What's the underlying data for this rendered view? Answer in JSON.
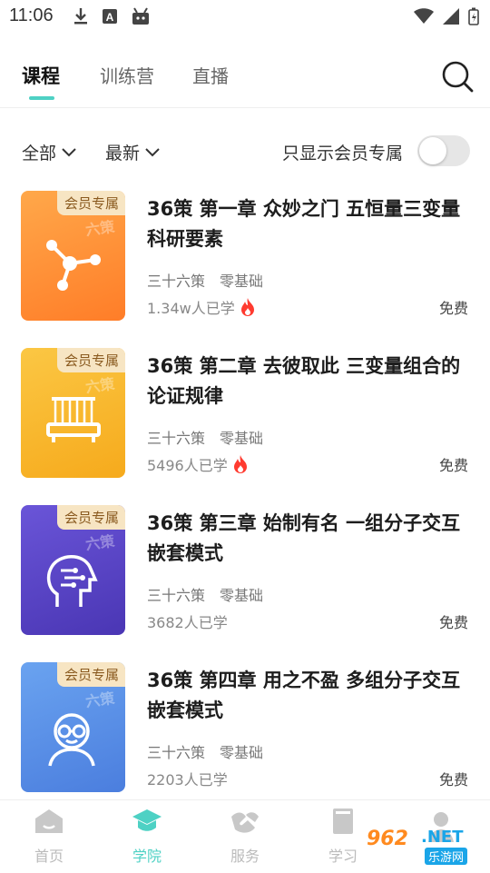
{
  "status_bar": {
    "time": "11:06"
  },
  "header": {
    "tabs": [
      {
        "label": "课程",
        "active": true
      },
      {
        "label": "训练营",
        "active": false
      },
      {
        "label": "直播",
        "active": false
      }
    ],
    "accent": "#4ed1c4"
  },
  "filters": {
    "category": "全部",
    "sort": "最新",
    "member_only_label": "只显示会员专属",
    "member_only_on": false
  },
  "courses": [
    {
      "badge": "会员专属",
      "watermark": "六策",
      "title": "36策 第一章 众妙之门 五恒量三变量科研要素",
      "series": "三十六策",
      "level": "零基础",
      "learners": "1.34w人已学",
      "hot": true,
      "price": "免费",
      "thumb_color": "#ff9a3d",
      "icon": "molecule-icon"
    },
    {
      "badge": "会员专属",
      "watermark": "六策",
      "title": "36策 第二章 去彼取此 三变量组合的论证规律",
      "series": "三十六策",
      "level": "零基础",
      "learners": "5496人已学",
      "hot": true,
      "price": "免费",
      "thumb_color": "#f5b92e",
      "icon": "abacus-icon"
    },
    {
      "badge": "会员专属",
      "watermark": "六策",
      "title": "36策 第三章 始制有名 一组分子交互嵌套模式",
      "series": "三十六策",
      "level": "零基础",
      "learners": "3682人已学",
      "hot": false,
      "price": "免费",
      "thumb_color": "#5a46c8",
      "icon": "brain-head-icon"
    },
    {
      "badge": "会员专属",
      "watermark": "六策",
      "title": "36策 第四章 用之不盈 多组分子交互嵌套模式",
      "series": "三十六策",
      "level": "零基础",
      "learners": "2203人已学",
      "hot": false,
      "price": "免费",
      "thumb_color": "#5b8fe8",
      "icon": "scholar-icon"
    }
  ],
  "bottom_nav": [
    {
      "label": "首页",
      "icon": "home-icon",
      "active": false
    },
    {
      "label": "学院",
      "icon": "graduation-cap-icon",
      "active": true
    },
    {
      "label": "服务",
      "icon": "handshake-icon",
      "active": false
    },
    {
      "label": "学习",
      "icon": "book-icon",
      "active": false
    }
  ],
  "watermark_brand": {
    "number": "962",
    "suffix": ".NET",
    "name": "乐游网"
  }
}
